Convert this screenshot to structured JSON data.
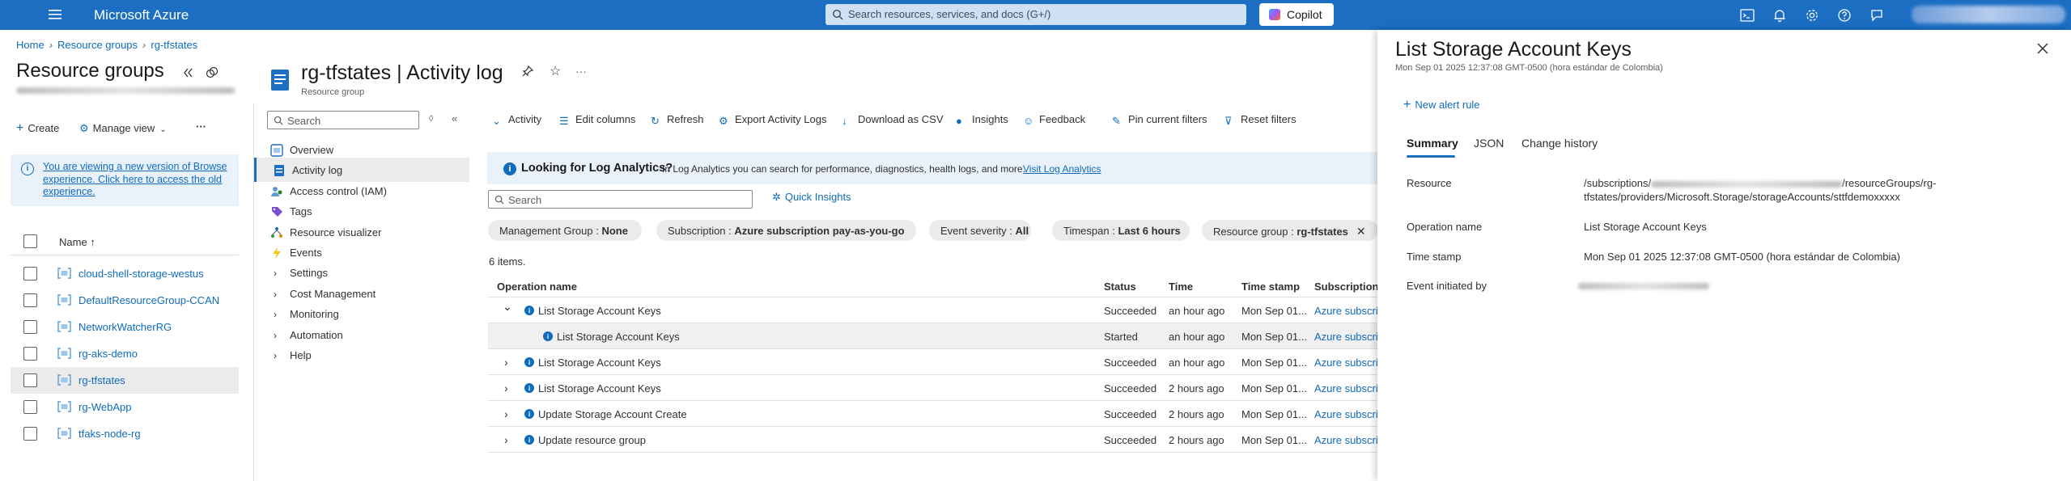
{
  "topbar": {
    "brand": "Microsoft Azure",
    "search_placeholder": "Search resources, services, and docs (G+/)",
    "copilot": "Copilot"
  },
  "breadcrumb": [
    "Home",
    "Resource groups",
    "rg-tfstates"
  ],
  "left": {
    "title": "Resource groups",
    "create": "Create",
    "manage_view": "Manage view",
    "more": "···",
    "notice": "You are viewing a new version of Browse experience. Click here to access the old experience.",
    "name_header": "Name ↑",
    "items": [
      {
        "label": "cloud-shell-storage-westus",
        "selected": false
      },
      {
        "label": "DefaultResourceGroup-CCAN",
        "selected": false
      },
      {
        "label": "NetworkWatcherRG",
        "selected": false
      },
      {
        "label": "rg-aks-demo",
        "selected": false
      },
      {
        "label": "rg-tfstates",
        "selected": true
      },
      {
        "label": "rg-WebApp",
        "selected": false
      },
      {
        "label": "tfaks-node-rg",
        "selected": false
      }
    ]
  },
  "nav": {
    "search_placeholder": "Search",
    "items": [
      {
        "label": "Overview",
        "type": "item"
      },
      {
        "label": "Activity log",
        "type": "item",
        "selected": true
      },
      {
        "label": "Access control (IAM)",
        "type": "item"
      },
      {
        "label": "Tags",
        "type": "item"
      },
      {
        "label": "Resource visualizer",
        "type": "item"
      },
      {
        "label": "Events",
        "type": "item"
      },
      {
        "label": "Settings",
        "type": "group"
      },
      {
        "label": "Cost Management",
        "type": "group"
      },
      {
        "label": "Monitoring",
        "type": "group"
      },
      {
        "label": "Automation",
        "type": "group"
      },
      {
        "label": "Help",
        "type": "group"
      }
    ]
  },
  "main": {
    "title": "rg-tfstates | Activity log",
    "subtitle": "Resource group",
    "commands": [
      "Activity",
      "Edit columns",
      "Refresh",
      "Export Activity Logs",
      "Download as CSV",
      "Insights",
      "Feedback",
      "Pin current filters",
      "Reset filters"
    ],
    "banner": {
      "title": "Looking for Log Analytics?",
      "text": "In Log Analytics you can search for performance, diagnostics, health logs, and more.",
      "link": "Visit Log Analytics"
    },
    "search_placeholder": "Search",
    "quick_insights": "Quick Insights",
    "filters": [
      {
        "k": "Management Group : ",
        "v": "None"
      },
      {
        "k": "Subscription : ",
        "v": "Azure subscription pay-as-you-go"
      },
      {
        "k": "Event severity : ",
        "v": "All"
      },
      {
        "k": "Timespan : ",
        "v": "Last 6 hours"
      },
      {
        "k": "Resource group : ",
        "v": "rg-tfstates"
      }
    ],
    "items_count": "6 items.",
    "columns": [
      "Operation name",
      "Status",
      "Time",
      "Time stamp",
      "Subscription"
    ],
    "rows": [
      {
        "op": "List Storage Account Keys",
        "status": "Succeeded",
        "time": "an hour ago",
        "stamp": "Mon Sep 01...",
        "sub": "Azure subscrip",
        "expanded": true,
        "child": false
      },
      {
        "op": "List Storage Account Keys",
        "status": "Started",
        "time": "an hour ago",
        "stamp": "Mon Sep 01...",
        "sub": "Azure subscrip",
        "child": true
      },
      {
        "op": "List Storage Account Keys",
        "status": "Succeeded",
        "time": "an hour ago",
        "stamp": "Mon Sep 01...",
        "sub": "Azure subscrip",
        "child": false
      },
      {
        "op": "List Storage Account Keys",
        "status": "Succeeded",
        "time": "2 hours ago",
        "stamp": "Mon Sep 01...",
        "sub": "Azure subscrip",
        "child": false
      },
      {
        "op": "Update Storage Account Create",
        "status": "Succeeded",
        "time": "2 hours ago",
        "stamp": "Mon Sep 01...",
        "sub": "Azure subscrip",
        "child": false
      },
      {
        "op": "Update resource group",
        "status": "Succeeded",
        "time": "2 hours ago",
        "stamp": "Mon Sep 01...",
        "sub": "Azure subscrip",
        "child": false
      }
    ]
  },
  "detail": {
    "title": "List Storage Account Keys",
    "subtitle": "Mon Sep 01 2025 12:37:08 GMT-0500 (hora estándar de Colombia)",
    "new_alert": "New alert rule",
    "tabs": [
      "Summary",
      "JSON",
      "Change history"
    ],
    "resource_label": "Resource",
    "resource_prefix": "/subscriptions/",
    "resource_suffix": "/resourceGroups/rg-",
    "resource_line2": "tfstates/providers/Microsoft.Storage/storageAccounts/sttfdemoxxxxx",
    "operation_label": "Operation name",
    "operation_value": "List Storage Account Keys",
    "timestamp_label": "Time stamp",
    "timestamp_value": "Mon Sep 01 2025 12:37:08 GMT-0500 (hora estándar de Colombia)",
    "initiated_label": "Event initiated by"
  }
}
